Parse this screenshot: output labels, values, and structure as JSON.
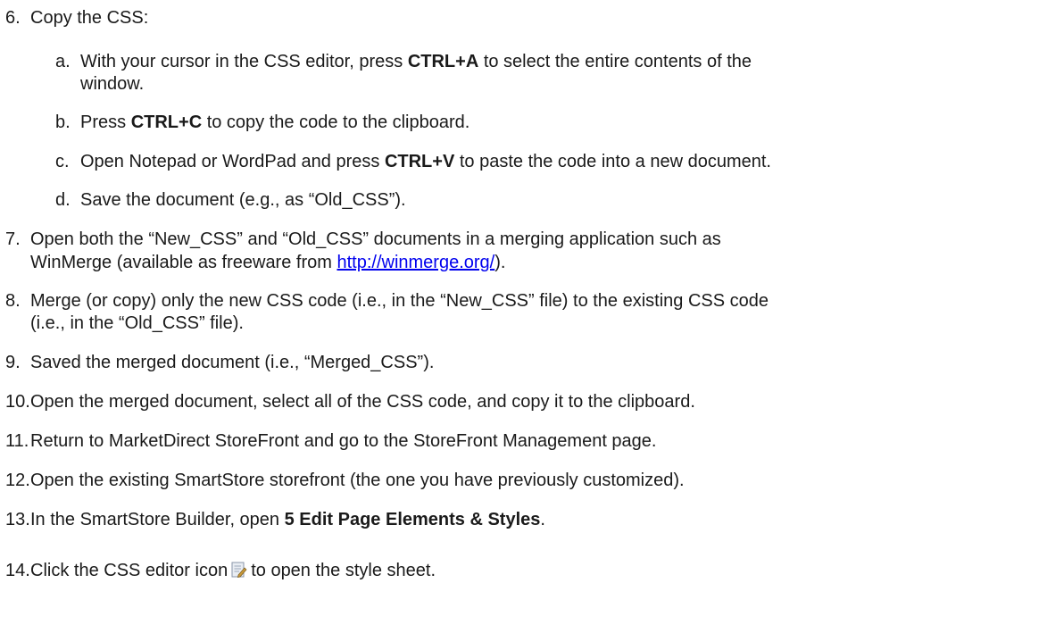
{
  "steps": {
    "s6": {
      "num": "6.",
      "text": "Copy the CSS:"
    },
    "sa": {
      "num": "a.",
      "pre": "With your cursor in the CSS editor, press ",
      "bold": "CTRL+A",
      "post": " to select the entire contents of the",
      "cont": "window."
    },
    "sb": {
      "num": "b.",
      "pre": "Press ",
      "bold": "CTRL+C",
      "post": " to copy the code to the clipboard."
    },
    "sc": {
      "num": "c.",
      "pre": "Open Notepad or WordPad and press ",
      "bold": "CTRL+V",
      "post": " to paste the code into a new document."
    },
    "sd": {
      "num": "d.",
      "text": "Save the document (e.g., as “Old_CSS”)."
    },
    "s7": {
      "num": "7.",
      "line1": "Open both the “New_CSS” and “Old_CSS” documents in a merging application such as",
      "line2_pre": "WinMerge (available as freeware from ",
      "link": "http://winmerge.org/",
      "line2_post": ")."
    },
    "s8": {
      "num": "8.",
      "line1": "Merge (or copy) only the new CSS code (i.e., in the “New_CSS” file) to the existing CSS code",
      "line2": "(i.e., in the “Old_CSS” file)."
    },
    "s9": {
      "num": "9.",
      "text": "Saved the merged document (i.e., “Merged_CSS”)."
    },
    "s10": {
      "num": "10.",
      "text": "Open the merged document, select all of the CSS code, and copy it to the clipboard."
    },
    "s11": {
      "num": "11.",
      "text": "Return to MarketDirect StoreFront and go to the StoreFront Management page."
    },
    "s12": {
      "num": "12.",
      "text": "Open the existing SmartStore storefront (the one you have previously customized)."
    },
    "s13": {
      "num": "13.",
      "pre": "In the SmartStore Builder, open ",
      "bold": "5 Edit Page Elements & Styles",
      "post": "."
    },
    "s14": {
      "num": "14.",
      "pre": "Click the CSS editor icon",
      "post": "to open the style sheet."
    }
  },
  "icons": {
    "css_editor": "css-editor-icon"
  }
}
